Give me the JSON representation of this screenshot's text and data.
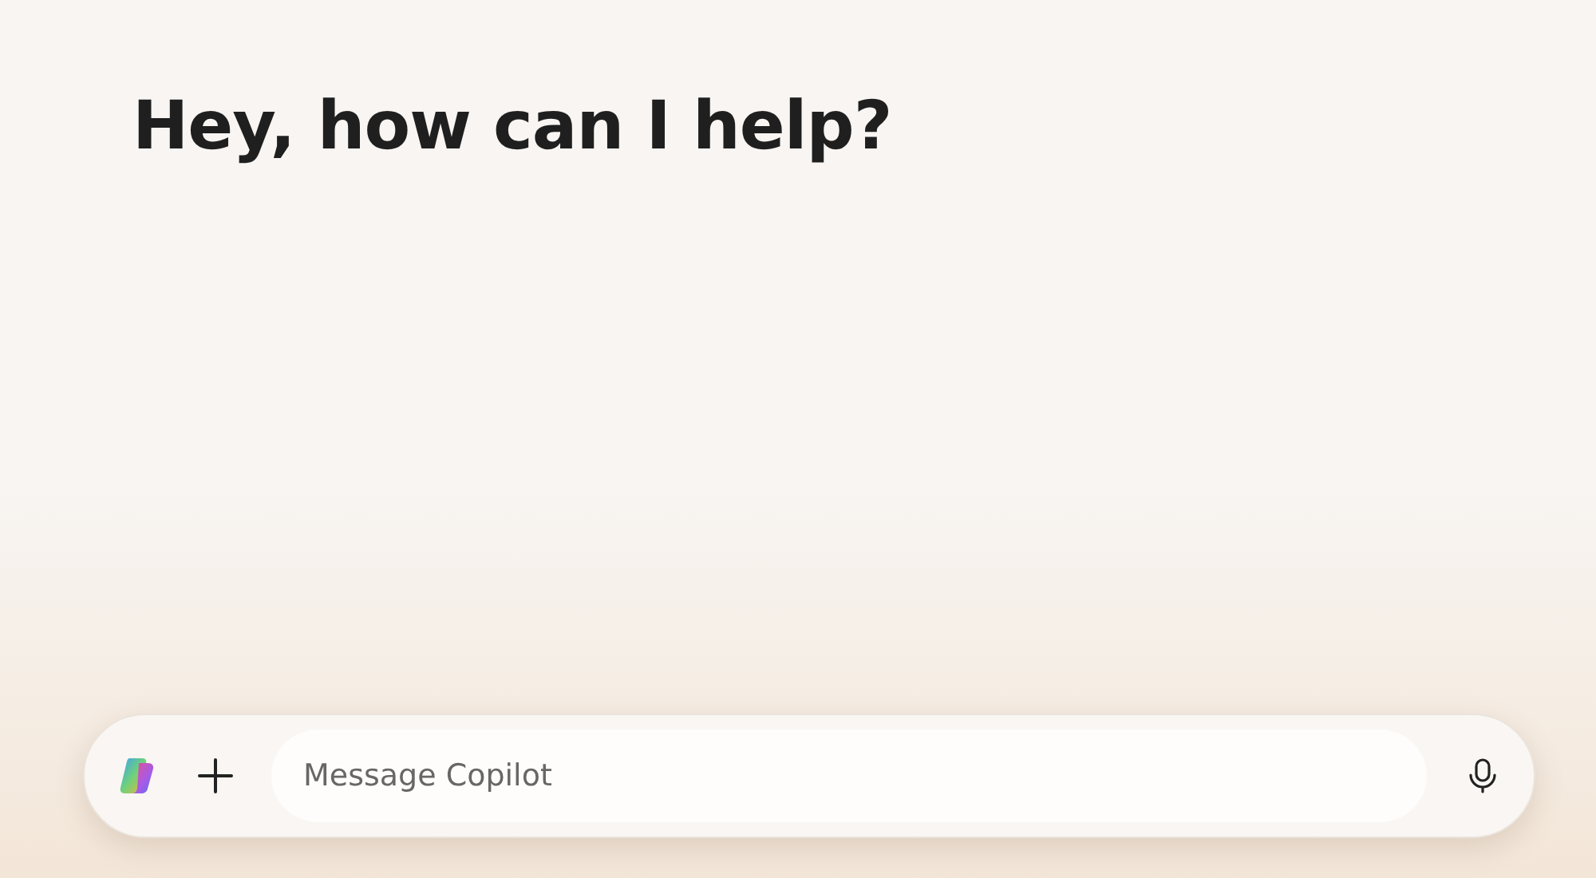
{
  "greeting": "Hey, how can I help?",
  "composer": {
    "placeholder": "Message Copilot"
  }
}
